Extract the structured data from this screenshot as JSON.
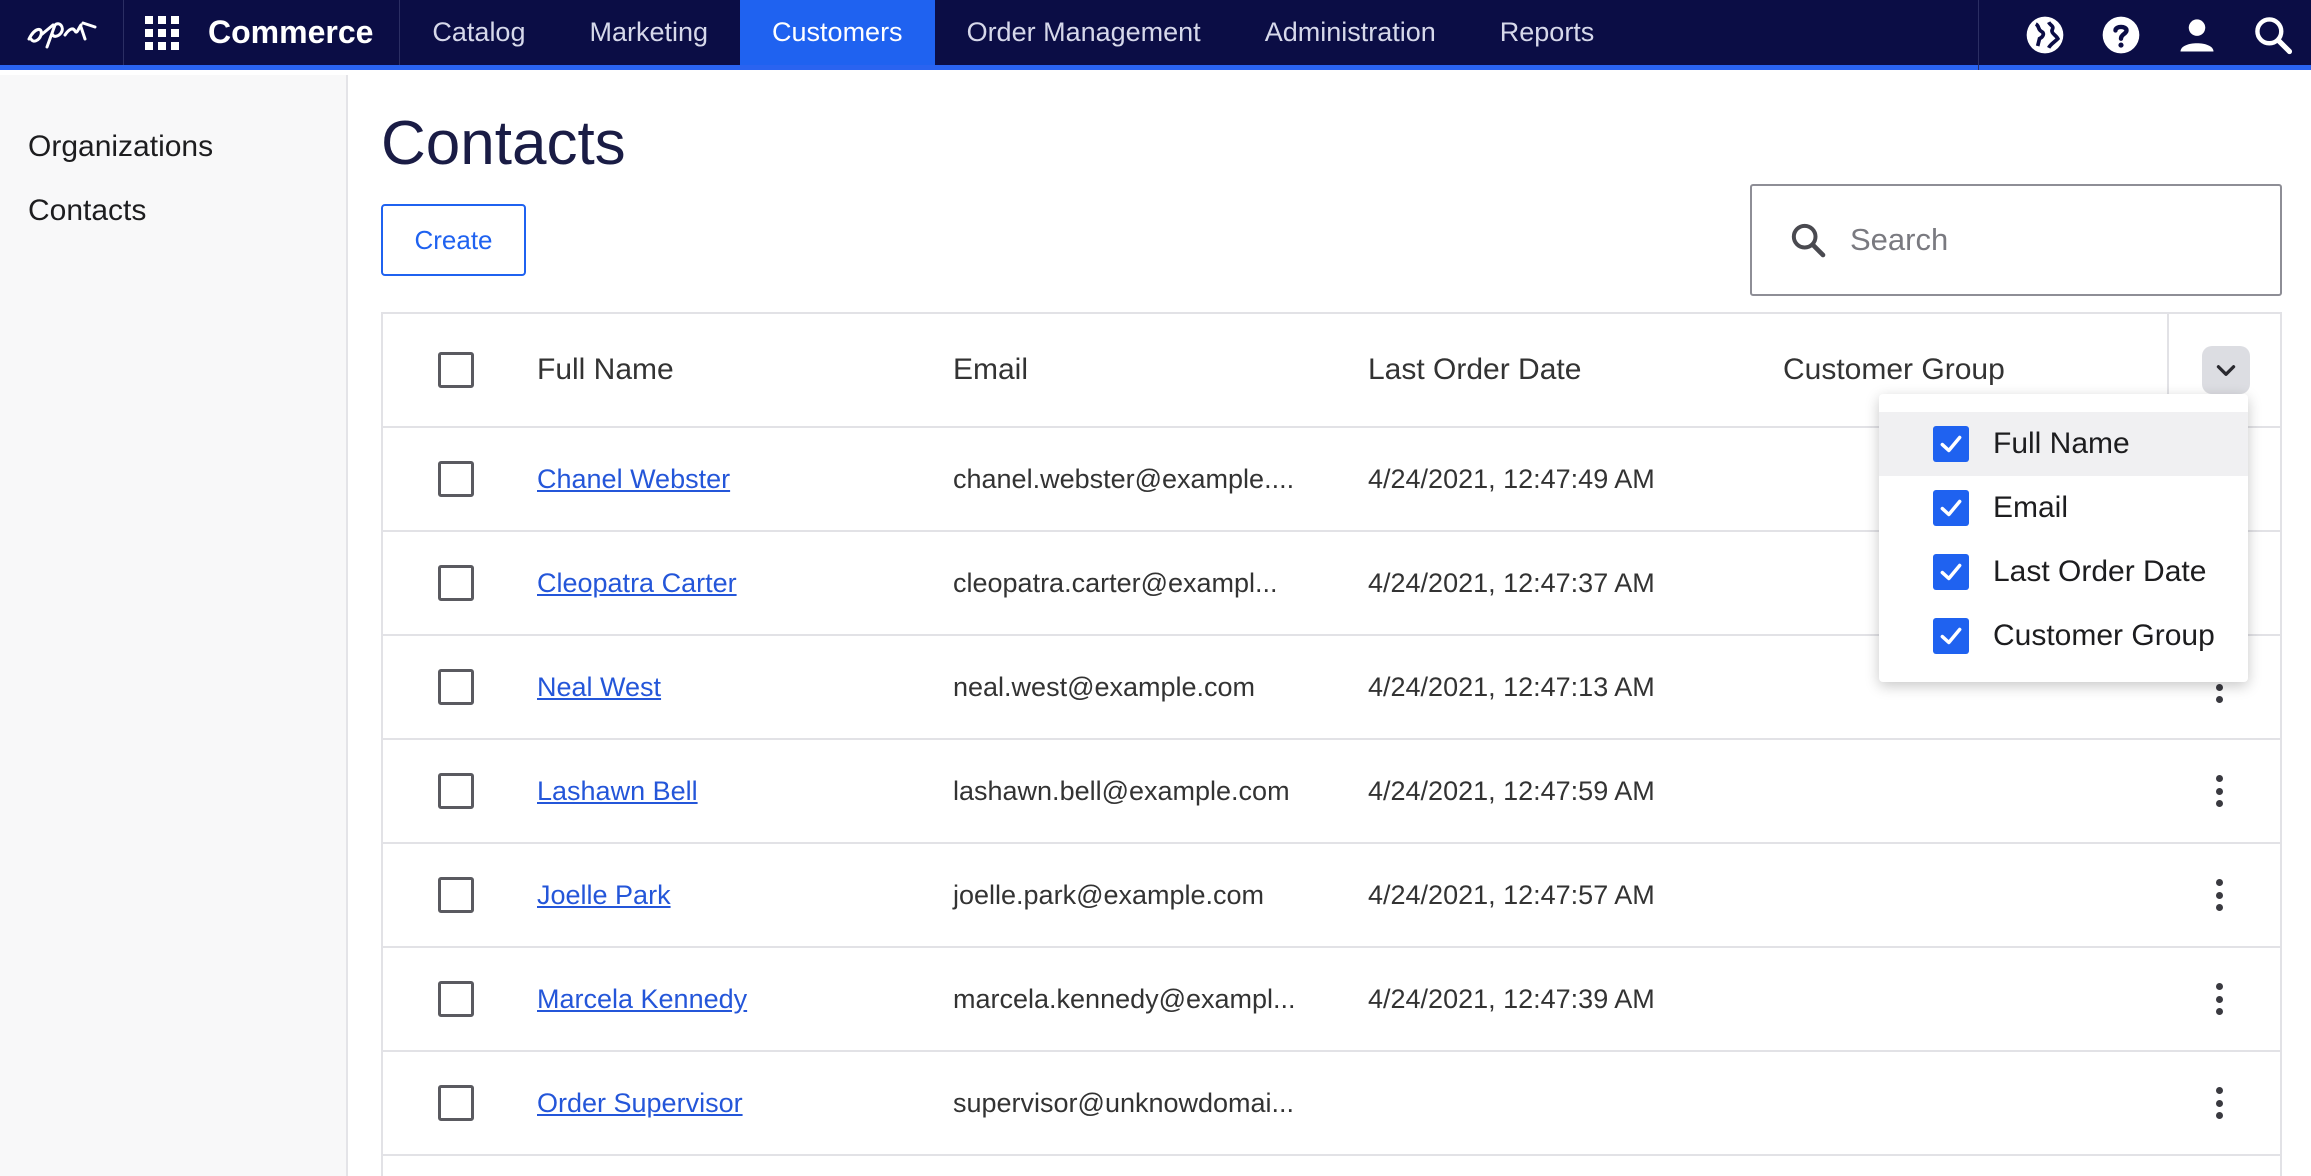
{
  "app": {
    "brand": "Commerce",
    "logo_text": "epi"
  },
  "nav": {
    "items": [
      {
        "label": "Catalog",
        "active": false
      },
      {
        "label": "Marketing",
        "active": false
      },
      {
        "label": "Customers",
        "active": true
      },
      {
        "label": "Order Management",
        "active": false
      },
      {
        "label": "Administration",
        "active": false
      },
      {
        "label": "Reports",
        "active": false
      }
    ],
    "right_icons": [
      "globe-icon",
      "help-icon",
      "user-icon",
      "search-icon"
    ]
  },
  "sidebar": {
    "items": [
      {
        "label": "Organizations"
      },
      {
        "label": "Contacts"
      }
    ]
  },
  "page": {
    "title": "Contacts",
    "create_label": "Create",
    "search_placeholder": "Search"
  },
  "table": {
    "columns": [
      "Full Name",
      "Email",
      "Last Order Date",
      "Customer Group"
    ],
    "rows": [
      {
        "name": "Chanel Webster",
        "email": "chanel.webster@example....",
        "last_order": "4/24/2021, 12:47:49 AM",
        "group": ""
      },
      {
        "name": "Cleopatra Carter",
        "email": "cleopatra.carter@exampl...",
        "last_order": "4/24/2021, 12:47:37 AM",
        "group": ""
      },
      {
        "name": "Neal West",
        "email": "neal.west@example.com",
        "last_order": "4/24/2021, 12:47:13 AM",
        "group": ""
      },
      {
        "name": "Lashawn Bell",
        "email": "lashawn.bell@example.com",
        "last_order": "4/24/2021, 12:47:59 AM",
        "group": ""
      },
      {
        "name": "Joelle Park",
        "email": "joelle.park@example.com",
        "last_order": "4/24/2021, 12:47:57 AM",
        "group": ""
      },
      {
        "name": "Marcela Kennedy",
        "email": "marcela.kennedy@exampl...",
        "last_order": "4/24/2021, 12:47:39 AM",
        "group": ""
      },
      {
        "name": "Order Supervisor",
        "email": "supervisor@unknowdomai...",
        "last_order": "",
        "group": ""
      }
    ]
  },
  "column_menu": {
    "items": [
      {
        "label": "Full Name",
        "checked": true
      },
      {
        "label": "Email",
        "checked": true
      },
      {
        "label": "Last Order Date",
        "checked": true
      },
      {
        "label": "Customer Group",
        "checked": true
      }
    ]
  },
  "colors": {
    "nav_bg": "#0b0d45",
    "accent": "#1f62f0",
    "link": "#2456d9"
  }
}
